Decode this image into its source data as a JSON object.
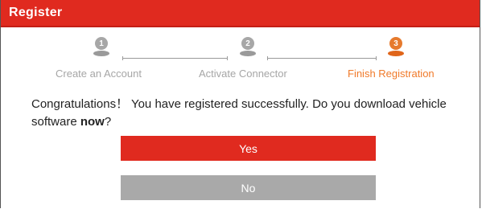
{
  "dialog": {
    "title": "Register",
    "colors": {
      "accent": "#e02a1f",
      "active_step": "#f07a2a",
      "inactive_step": "#a6a6a6",
      "no_button": "#a9a9a9"
    }
  },
  "steps": [
    {
      "number": "1",
      "label": "Create an Account",
      "state": "done",
      "icon": "map-pin-icon"
    },
    {
      "number": "2",
      "label": "Activate Connector",
      "state": "done",
      "icon": "map-pin-icon"
    },
    {
      "number": "3",
      "label": "Finish Registration",
      "state": "current",
      "icon": "map-pin-icon"
    }
  ],
  "message": {
    "text_before": "Congratulations！ You have registered successfully. Do you download vehicle software ",
    "emphasis": "now",
    "text_after": "?"
  },
  "buttons": {
    "yes_label": "Yes",
    "no_label": "No"
  }
}
